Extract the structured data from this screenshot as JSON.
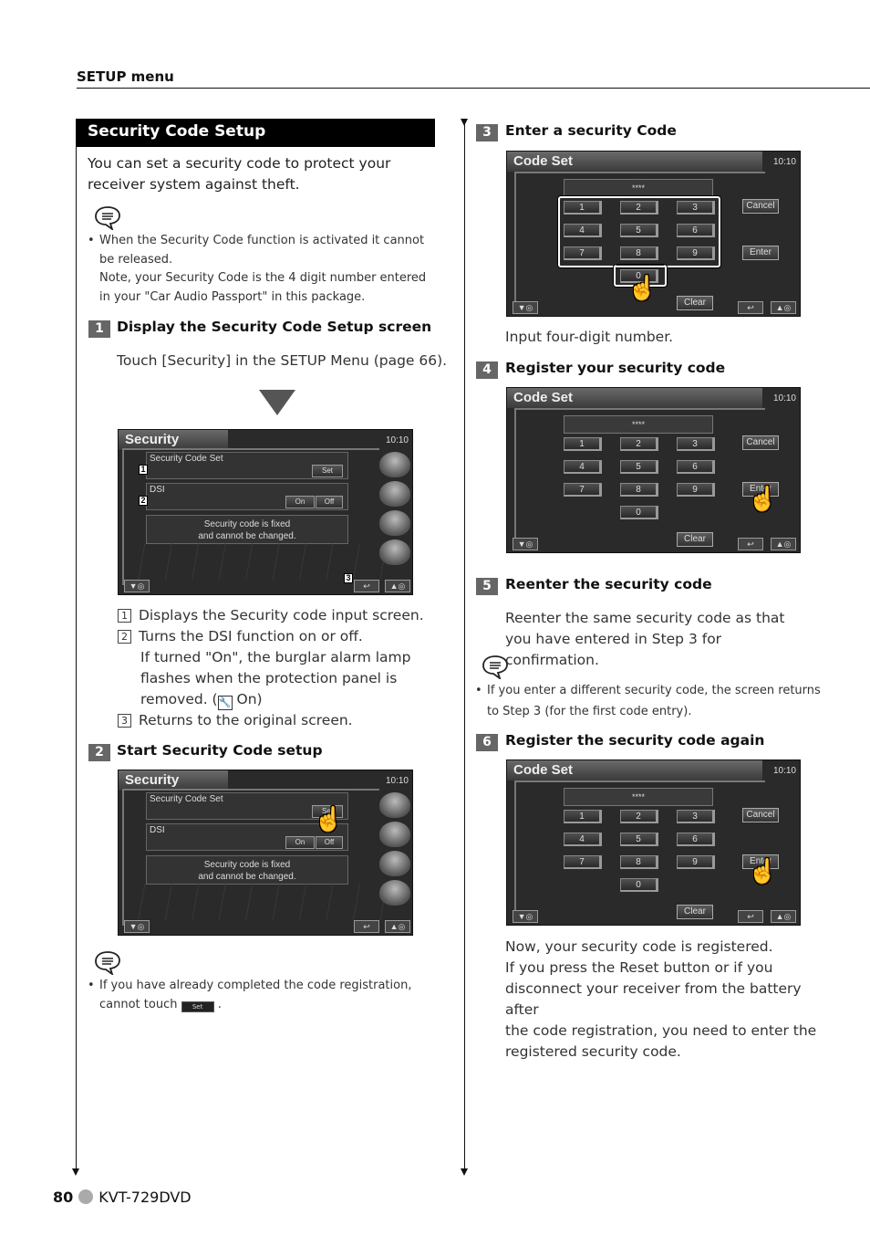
{
  "header": {
    "section": "SETUP menu"
  },
  "title": "Security Code Setup",
  "intro": "You can set a security code to protect your receiver system against theft.",
  "note1": {
    "icon": "note-speech-icon",
    "line1": "When the Security Code function is activated it cannot be released.",
    "line2": "Note, your Security Code is the 4 digit number entered in your \"Car Audio Passport\" in this package."
  },
  "steps": [
    {
      "num": "1",
      "title": "Display the Security Code Setup screen",
      "text": "Touch [Security] in the SETUP Menu (page 66)."
    },
    {
      "num": "2",
      "title": "Start Security Code setup"
    },
    {
      "num": "3",
      "title": "Enter a security Code",
      "text": "Input four-digit number."
    },
    {
      "num": "4",
      "title": "Register your security code"
    },
    {
      "num": "5",
      "title": "Reenter the security code",
      "text": "Reenter the same security code as that you have entered in Step 3 for confirmation."
    },
    {
      "num": "6",
      "title": "Register the security code again"
    }
  ],
  "security_screen": {
    "title": "Security",
    "clock": "10:10",
    "code_set_label": "Security Code Set",
    "set_button": "Set",
    "dsi_label": "DSI",
    "on_button": "On",
    "off_button": "Off",
    "message_line1": "Security code is fixed",
    "message_line2": "and cannot be changed.",
    "callouts": [
      "1",
      "2",
      "3"
    ]
  },
  "callout_list": [
    {
      "num": "1",
      "text": "Displays the Security code input screen."
    },
    {
      "num": "2",
      "text": "Turns the DSI function on or off.",
      "extra1": "If turned \"On\", the burglar alarm lamp",
      "extra2": "flashes when the protection panel is",
      "extra3_pre": "removed. (",
      "extra3_post": " On)"
    },
    {
      "num": "3",
      "text": "Returns to the original screen."
    }
  ],
  "note2": {
    "line1": "If you have already completed the code registration,",
    "line2_pre": "cannot touch",
    "line2_post": ".",
    "inline_button": "Set"
  },
  "code_screen": {
    "title": "Code Set",
    "clock": "10:10",
    "code_value": "****",
    "keys": [
      "1",
      "2",
      "3",
      "4",
      "5",
      "6",
      "7",
      "8",
      "9",
      "0"
    ],
    "cancel": "Cancel",
    "enter": "Enter",
    "clear": "Clear"
  },
  "note3": {
    "line1": "If you enter a different security code, the screen returns",
    "line2": "to Step 3 (for the first code entry)."
  },
  "final_text": [
    "Now, your security code is registered.",
    "If you press the Reset button or if you",
    "disconnect your receiver from the battery after",
    "the code registration, you need to enter the",
    "registered security code."
  ],
  "footer": {
    "page": "80",
    "model": "KVT-729DVD"
  }
}
